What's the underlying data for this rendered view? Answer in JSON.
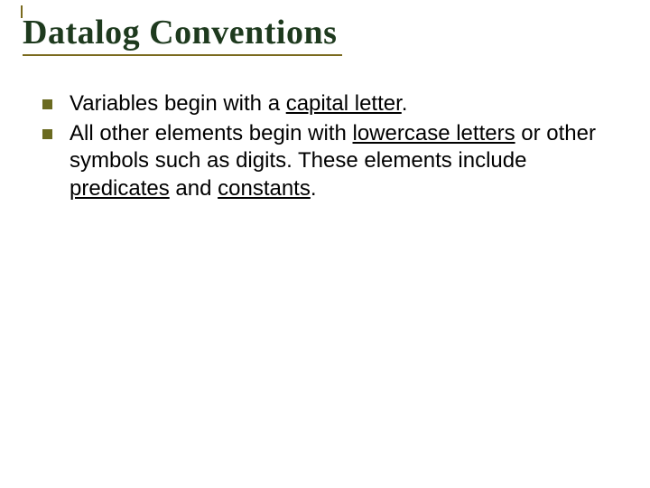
{
  "slide": {
    "title": "Datalog Conventions",
    "bullets": [
      {
        "pre1": "Variables",
        "mid1": " begin with a ",
        "u1": "capital letter",
        "post1": "."
      },
      {
        "pre1": "All other elements begin with ",
        "u1": "lowercase letters",
        "mid1": " or other symbols such as digits. These elements include ",
        "u2": "predicates",
        "mid2": " and ",
        "u3": "constants",
        "post1": "."
      }
    ]
  }
}
